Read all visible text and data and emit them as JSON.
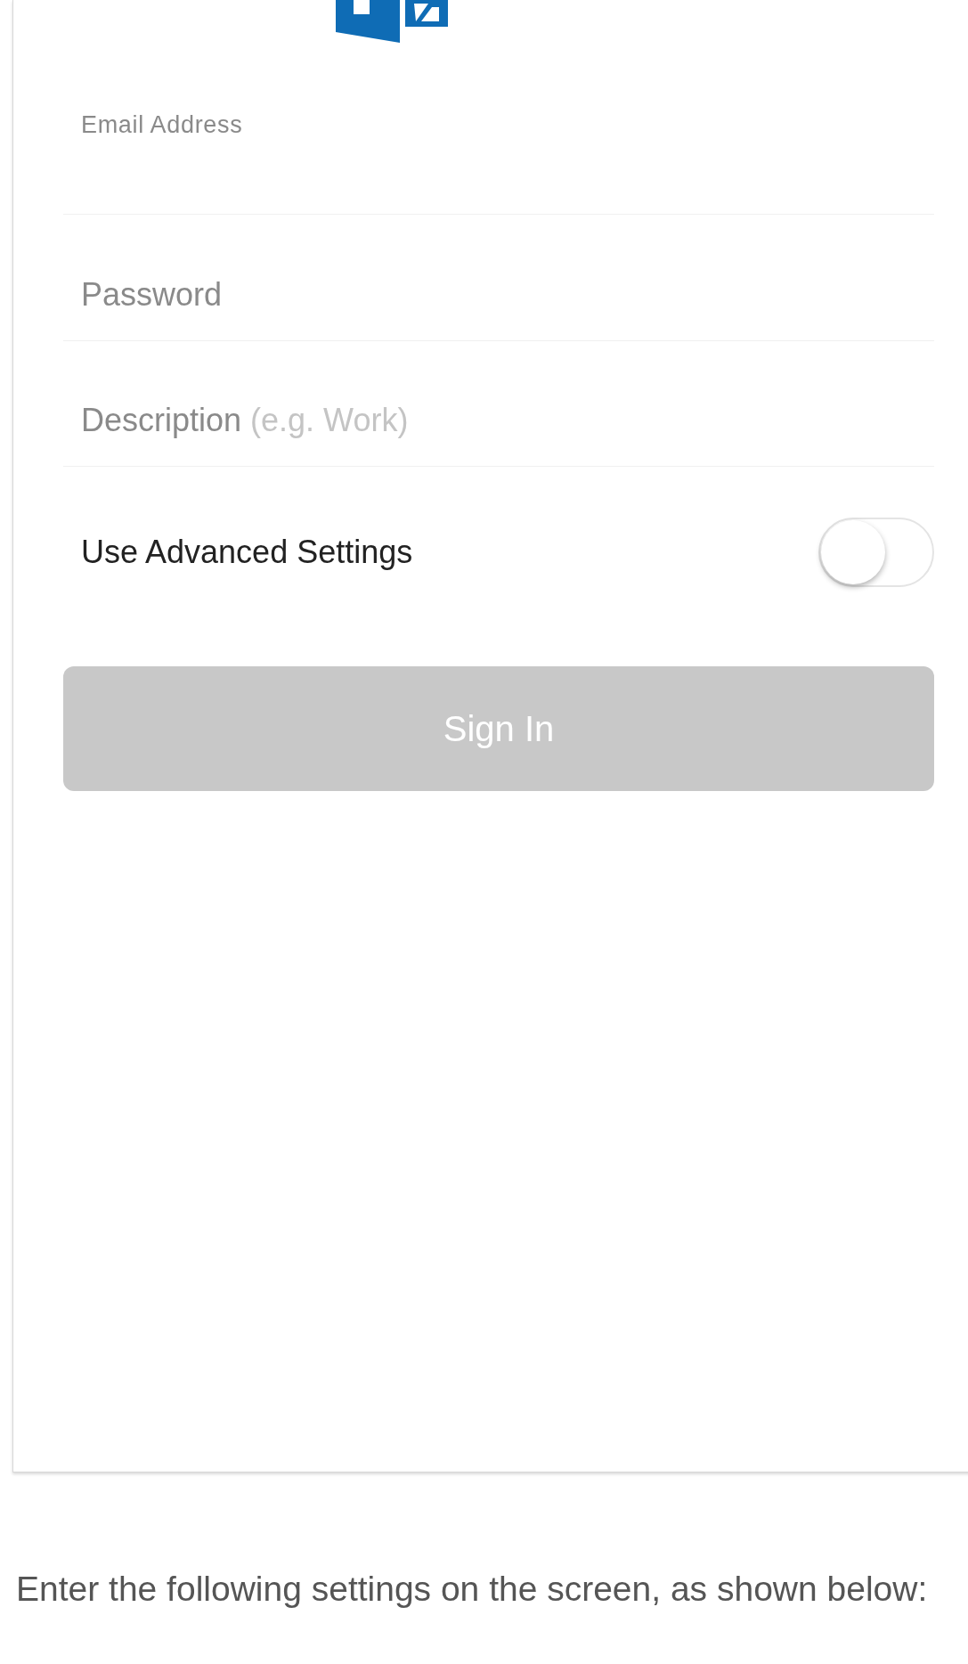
{
  "fields": [
    {
      "kind": "floating",
      "label": "Email Address"
    },
    {
      "kind": "plain",
      "placeholder": "Password"
    },
    {
      "kind": "hinted",
      "placeholder": "Description",
      "hint": "(e.g. Work)"
    }
  ],
  "advanced": {
    "label": "Use Advanced Settings",
    "on": false
  },
  "sign_in": {
    "label": "Sign In",
    "disabled": true
  },
  "instruction": "Enter the following settings on the screen, as shown below:"
}
